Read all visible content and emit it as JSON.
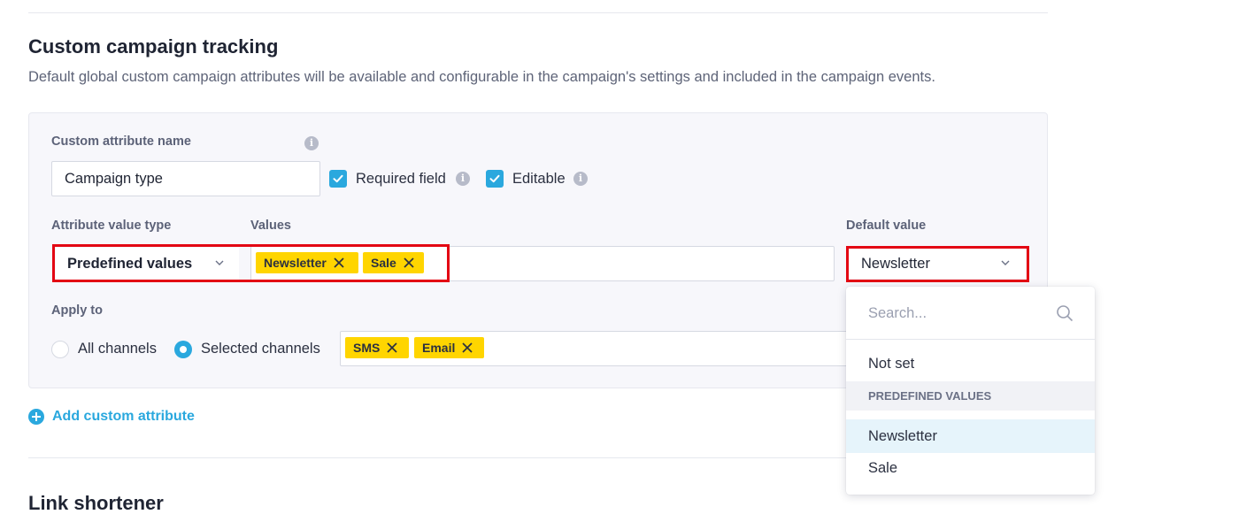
{
  "section": {
    "title": "Custom campaign tracking",
    "description": "Default global custom campaign attributes will be available and configurable in the campaign's settings and included in the campaign events."
  },
  "attribute": {
    "name_label": "Custom attribute name",
    "name_value": "Campaign type",
    "required_label": "Required field",
    "required_checked": true,
    "editable_label": "Editable",
    "editable_checked": true,
    "value_type_label": "Attribute value type",
    "value_type": "Predefined values",
    "values_label": "Values",
    "values": [
      "Newsletter",
      "Sale"
    ],
    "default_label": "Default value",
    "default_value": "Newsletter",
    "apply_label": "Apply to",
    "apply_options": [
      "All channels",
      "Selected channels"
    ],
    "apply_selected": "Selected channels",
    "channels": [
      "SMS",
      "Email"
    ]
  },
  "add_attribute_label": "Add custom attribute",
  "dropdown": {
    "search_placeholder": "Search...",
    "not_set": "Not set",
    "group_label": "PREDEFINED VALUES",
    "options": [
      "Newsletter",
      "Sale"
    ],
    "highlighted": "Newsletter"
  },
  "next_section_title": "Link shortener",
  "colors": {
    "accent": "#2aa8de",
    "tag": "#ffd500",
    "highlight_outline": "#e30613"
  }
}
